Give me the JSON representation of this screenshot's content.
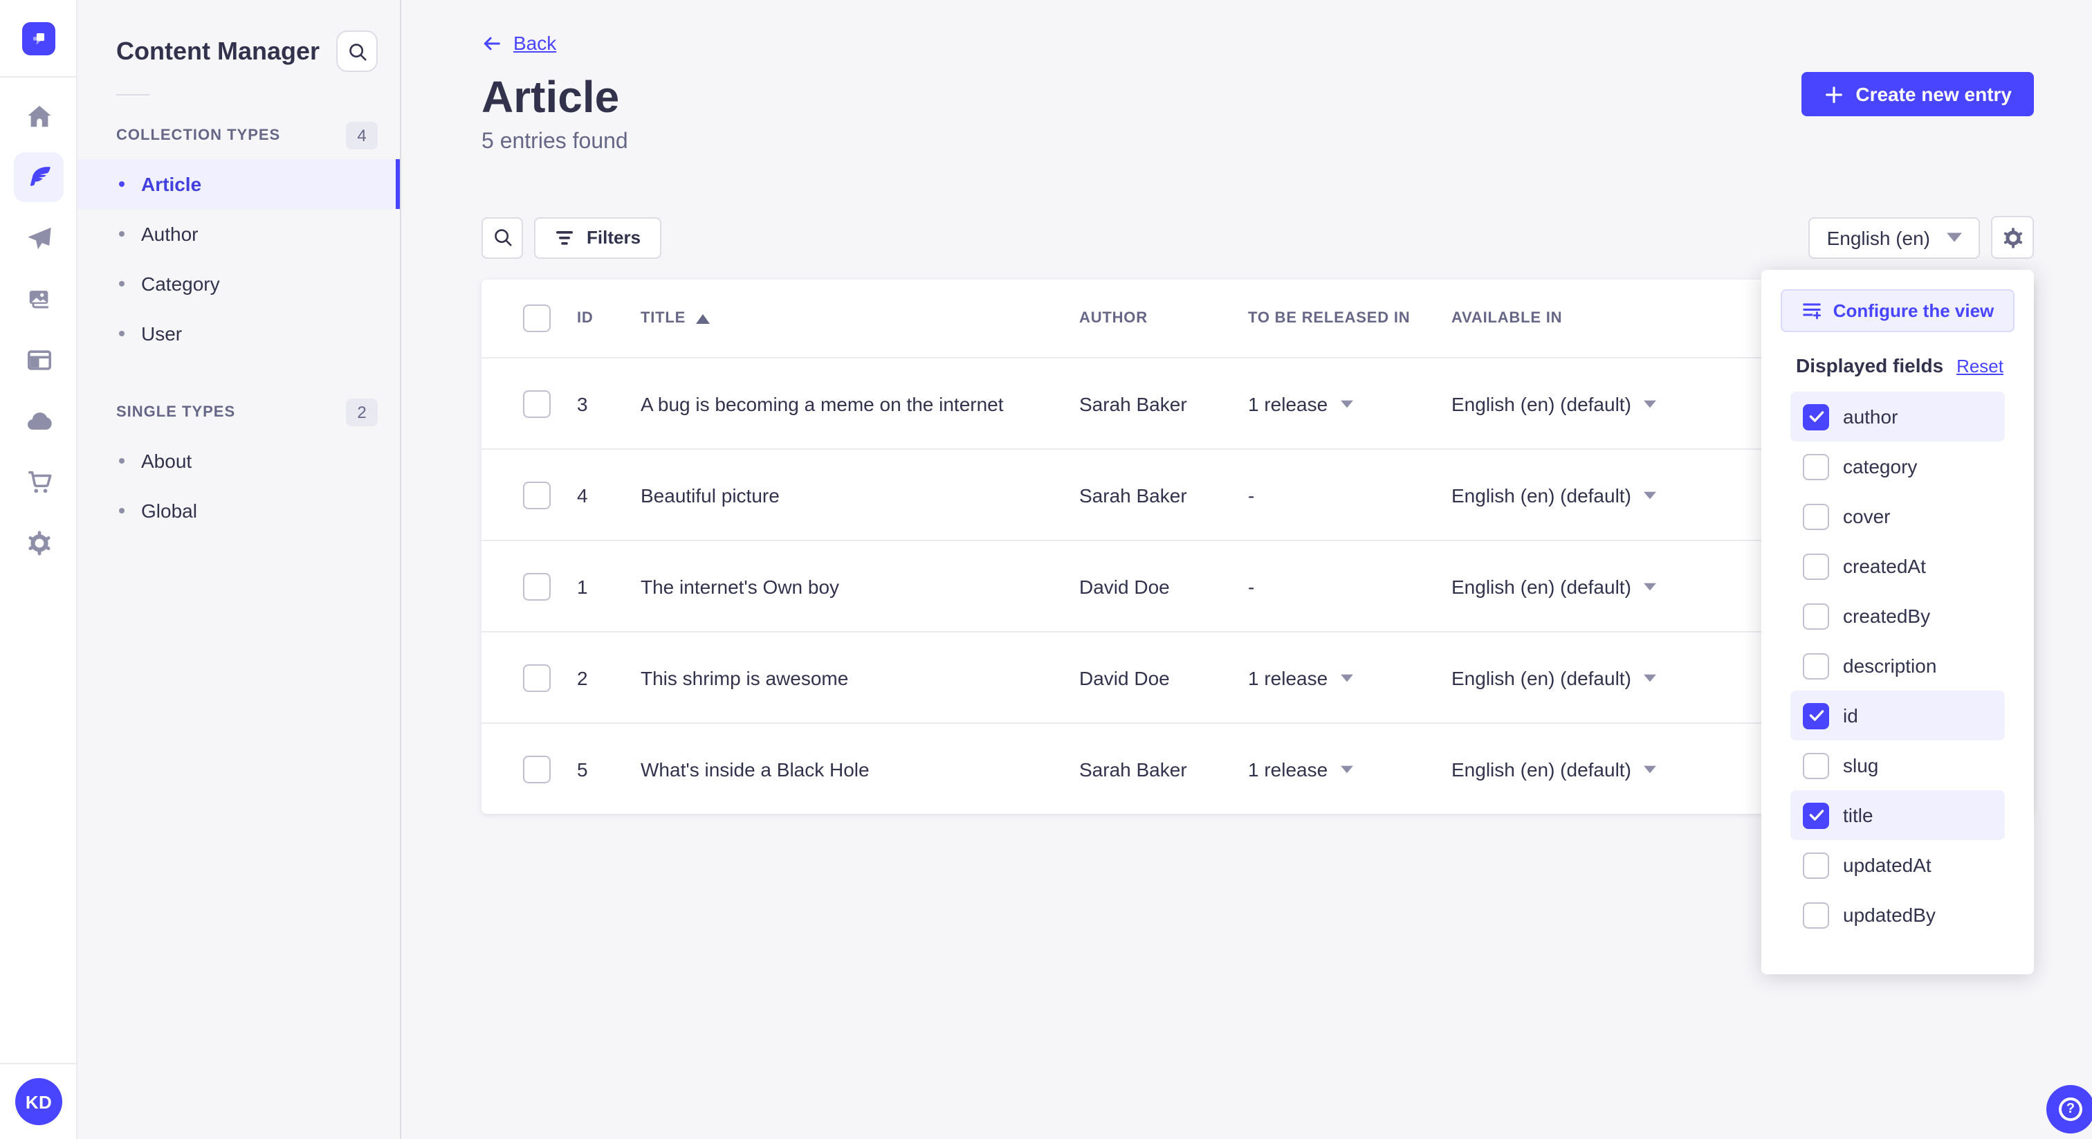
{
  "app": {
    "panel_title": "Content Manager"
  },
  "rail": {
    "icons": [
      "home-icon",
      "content-manager-icon",
      "releases-icon",
      "media-library-icon",
      "content-type-builder-icon",
      "cloud-icon",
      "marketplace-icon",
      "settings-icon"
    ]
  },
  "sidebar": {
    "title": "Content Manager",
    "sections": [
      {
        "label": "COLLECTION TYPES",
        "badge": "4",
        "items": [
          {
            "label": "Article",
            "active": true
          },
          {
            "label": "Author"
          },
          {
            "label": "Category"
          },
          {
            "label": "User"
          }
        ]
      },
      {
        "label": "SINGLE TYPES",
        "badge": "2",
        "items": [
          {
            "label": "About"
          },
          {
            "label": "Global"
          }
        ]
      }
    ]
  },
  "header": {
    "back_label": "Back",
    "title": "Article",
    "subtitle": "5 entries found",
    "create_button": "Create new entry"
  },
  "toolbar": {
    "filters_label": "Filters",
    "locale_value": "English (en)"
  },
  "table": {
    "columns": [
      "ID",
      "TITLE",
      "AUTHOR",
      "TO BE RELEASED IN",
      "AVAILABLE IN"
    ],
    "sorted_column": "TITLE",
    "sort_direction": "ascending",
    "rows": [
      {
        "id": "3",
        "title": "A bug is becoming a meme on the internet",
        "author": "Sarah Baker",
        "to_be_released_in": "1 release",
        "available_in": "English (en) (default)"
      },
      {
        "id": "4",
        "title": "Beautiful picture",
        "author": "Sarah Baker",
        "to_be_released_in": "-",
        "available_in": "English (en) (default)"
      },
      {
        "id": "1",
        "title": "The internet's Own boy",
        "author": "David Doe",
        "to_be_released_in": "-",
        "available_in": "English (en) (default)"
      },
      {
        "id": "2",
        "title": "This shrimp is awesome",
        "author": "David Doe",
        "to_be_released_in": "1 release",
        "available_in": "English (en) (default)"
      },
      {
        "id": "5",
        "title": "What's inside a Black Hole",
        "author": "Sarah Baker",
        "to_be_released_in": "1 release",
        "available_in": "English (en) (default)"
      }
    ]
  },
  "popover": {
    "configure_button": "Configure the view",
    "section_title": "Displayed fields",
    "reset_label": "Reset",
    "fields": [
      {
        "label": "author",
        "checked": true
      },
      {
        "label": "category",
        "checked": false
      },
      {
        "label": "cover",
        "checked": false
      },
      {
        "label": "createdAt",
        "checked": false
      },
      {
        "label": "createdBy",
        "checked": false
      },
      {
        "label": "description",
        "checked": false
      },
      {
        "label": "id",
        "checked": true
      },
      {
        "label": "slug",
        "checked": false
      },
      {
        "label": "title",
        "checked": true
      },
      {
        "label": "updatedAt",
        "checked": false
      },
      {
        "label": "updatedBy",
        "checked": false
      }
    ]
  },
  "user": {
    "initials": "KD"
  },
  "colors": {
    "primary": "#4945ff",
    "primary_light": "#f0f0ff",
    "text": "#32324d",
    "text_secondary": "#666687",
    "background": "#f6f6f9"
  }
}
